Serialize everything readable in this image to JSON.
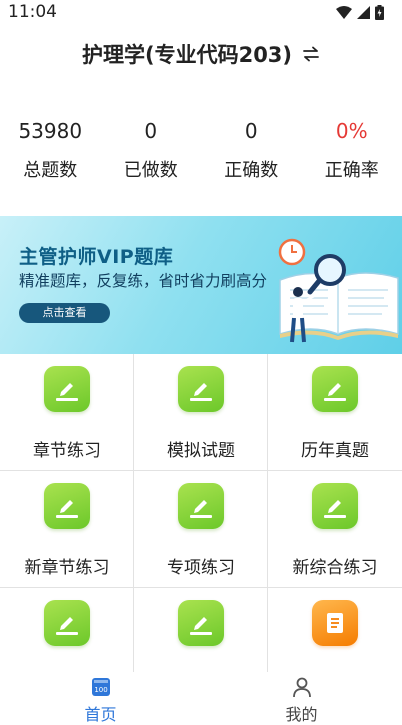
{
  "status_bar": {
    "time": "11:04"
  },
  "header": {
    "title": "护理学(专业代码203)"
  },
  "stats": [
    {
      "value": "53980",
      "label": "总题数"
    },
    {
      "value": "0",
      "label": "已做数"
    },
    {
      "value": "0",
      "label": "正确数"
    },
    {
      "value": "0%",
      "label": "正确率"
    }
  ],
  "banner": {
    "title": "主管护师VIP题库",
    "subtitle": "精准题库，反复练，省时省力刷高分",
    "cta": "点击查看"
  },
  "grid": [
    {
      "label": "章节练习",
      "icon": "pencil-icon"
    },
    {
      "label": "模拟试题",
      "icon": "pencil-icon"
    },
    {
      "label": "历年真题",
      "icon": "pencil-icon"
    },
    {
      "label": "新章节练习",
      "icon": "pencil-icon"
    },
    {
      "label": "专项练习",
      "icon": "pencil-icon"
    },
    {
      "label": "新综合练习",
      "icon": "pencil-icon"
    },
    {
      "label": "",
      "icon": "pencil-icon"
    },
    {
      "label": "",
      "icon": "pencil-icon"
    },
    {
      "label": "",
      "icon": "document-icon"
    }
  ],
  "bottom_nav": [
    {
      "label": "首页",
      "icon": "home-icon",
      "active": true
    },
    {
      "label": "我的",
      "icon": "user-icon",
      "active": false
    }
  ],
  "colors": {
    "accent": "#2f77d9",
    "rate": "#e53935",
    "icon_green": "#6cc82a",
    "icon_orange": "#f57c00"
  }
}
